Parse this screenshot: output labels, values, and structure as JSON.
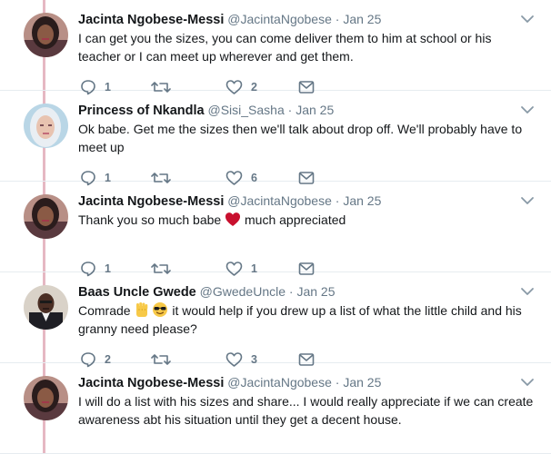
{
  "tweets": [
    {
      "name": "Jacinta Ngobese-Messi",
      "handle": "@JacintaNgobese",
      "date": "Jan 25",
      "text": "I can get you the sizes, you can come deliver them to him at school or his teacher or I can meet up wherever and get them.",
      "reply_count": "1",
      "retweet_count": "",
      "like_count": "2",
      "avatar": "jacinta"
    },
    {
      "name": "Princess of Nkandla",
      "handle": "@Sisi_Sasha",
      "date": "Jan 25",
      "text": "Ok babe. Get me the sizes then we'll talk about drop off. We'll probably have to meet up",
      "reply_count": "1",
      "retweet_count": "",
      "like_count": "6",
      "avatar": "princess"
    },
    {
      "name": "Jacinta Ngobese-Messi",
      "handle": "@JacintaNgobese",
      "date": "Jan 25",
      "text_before": "Thank you so much babe ",
      "text_after": " much appreciated",
      "emoji": "red-heart",
      "reply_count": "1",
      "retweet_count": "",
      "like_count": "1",
      "avatar": "jacinta"
    },
    {
      "name": "Baas Uncle Gwede",
      "handle": "@GwedeUncle",
      "date": "Jan 25",
      "text_before": "Comrade ",
      "text_after": " it would help if you drew up a list of what the little child and his granny need please?",
      "emoji": "raised-fist, sunglasses-face",
      "reply_count": "2",
      "retweet_count": "",
      "like_count": "3",
      "avatar": "gwede"
    },
    {
      "name": "Jacinta Ngobese-Messi",
      "handle": "@JacintaNgobese",
      "date": "Jan 25",
      "text": "I will do a list with his sizes and share... I would really appreciate if we can create awareness abt his situation until they get a decent house.",
      "avatar": "jacinta"
    }
  ],
  "separator": "·",
  "colors": {
    "name": "#14171a",
    "muted": "#657786",
    "thread_line": "#e6b8c3",
    "heart_emoji": "#c8102e"
  },
  "icons": [
    "reply-icon",
    "retweet-icon",
    "like-icon",
    "dm-icon",
    "chevron-down-icon"
  ]
}
